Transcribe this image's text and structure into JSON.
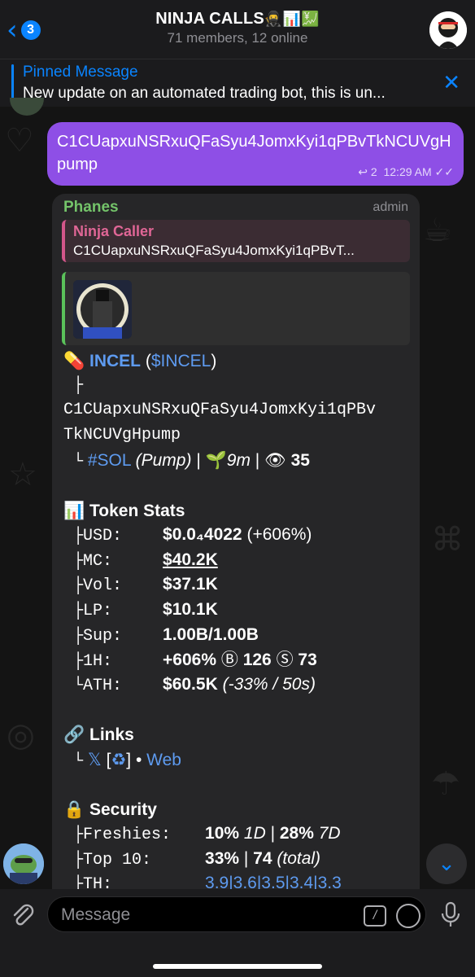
{
  "header": {
    "back_count": "3",
    "title": "NINJA CALLS",
    "title_emojis": "🥷📊💹",
    "subtitle": "71 members, 12 online"
  },
  "pinned": {
    "title": "Pinned Message",
    "text": "New update on an automated trading bot, this is un..."
  },
  "outgoing": {
    "text": "C1CUapxuNSRxuQFaSyu4JomxKyi1qPBvTkNCUVgHpump",
    "replies": "2",
    "time": "12:29 AM"
  },
  "incoming": {
    "sender": "Phanes",
    "role": "admin",
    "reply_name": "Ninja Caller",
    "reply_text": "C1CUapxuNSRxuQFaSyu4JomxKyi1qPBvT...",
    "token_name": "INCEL",
    "token_ticker": "$INCEL",
    "address_line1": "C1CUapxuNSRxuQFaSyu4JomxKyi1qPBv",
    "address_line2": "TkNCUVgHpump",
    "chain": "#SOL",
    "source": "(Pump)",
    "age": "9m",
    "views": "35",
    "stats_title": "Token Stats",
    "stats": {
      "usd_label": "USD:",
      "usd_value": "$0.0₄4022",
      "usd_change": "(+606%)",
      "mc_label": "MC:",
      "mc_value": "$40.2K",
      "vol_label": "Vol:",
      "vol_value": "$37.1K",
      "lp_label": "LP:",
      "lp_value": "$10.1K",
      "sup_label": "Sup:",
      "sup_value": "1.00B/1.00B",
      "h1_label": "1H:",
      "h1_change": "+606%",
      "h1_buys": "126",
      "h1_sells": "73",
      "ath_label": "ATH:",
      "ath_value": "$60.5K",
      "ath_detail": "(-33% / 50s)"
    },
    "links_title": "Links",
    "links_x": "𝕏",
    "links_web": "Web",
    "security_title": "Security",
    "security": {
      "freshies_label": "Freshies:",
      "freshies_1d": "10%",
      "freshies_1d_unit": "1D",
      "freshies_7d": "28%",
      "freshies_7d_unit": "7D",
      "top10_label": "Top 10:",
      "top10_pct": "33%",
      "top10_count": "74",
      "top10_unit": "(total)",
      "th_label": "TH:",
      "th_values": "3.9|3.6|3.5|3.4|3.3"
    }
  },
  "composer": {
    "placeholder": "Message"
  },
  "colors": {
    "accent": "#0a84ff",
    "outgoing_bubble": "#8e4fe6",
    "sender_name": "#74c46a",
    "reply_name": "#e06696",
    "link": "#5e9bf0"
  }
}
